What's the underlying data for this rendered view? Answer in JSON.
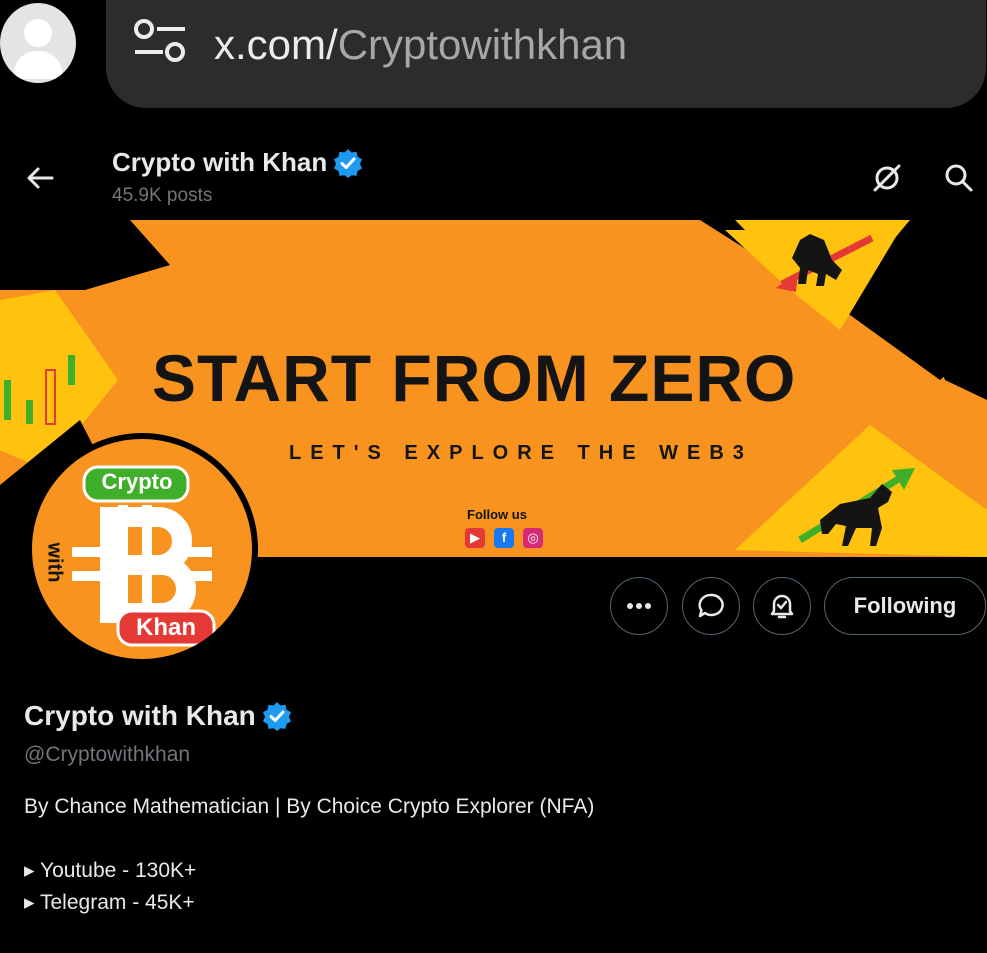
{
  "browser": {
    "url_host": "x.com/",
    "url_path": "Cryptowithkhan"
  },
  "header": {
    "name": "Crypto with Khan",
    "posts": "45.9K posts"
  },
  "banner": {
    "headline": "START FROM ZERO",
    "subline": "LET'S EXPLORE THE WEB3",
    "follow_label": "Follow us",
    "social_icons": [
      "youtube-icon",
      "facebook-icon",
      "instagram-icon"
    ]
  },
  "avatar": {
    "top_text": "Crypto",
    "side_text": "with",
    "bottom_text": "Khan"
  },
  "actions": {
    "follow_label": "Following"
  },
  "profile": {
    "name": "Crypto with Khan",
    "handle": "@Cryptowithkhan",
    "bio": "By Chance Mathematician | By Choice Crypto Explorer (NFA)",
    "links": [
      "▸ Youtube - 130K+",
      "▸ Telegram - 45K+"
    ]
  },
  "colors": {
    "accent_orange": "#f7931e",
    "banner_yellow": "#ffc20e",
    "verified_blue": "#1d9bf0",
    "muted_text": "#71767b",
    "green_up": "#3fae2a",
    "red_down": "#e53935"
  }
}
